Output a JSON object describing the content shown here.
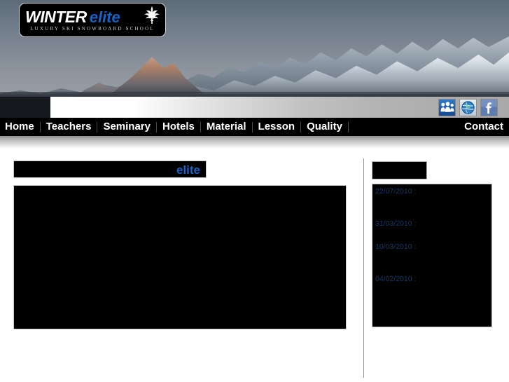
{
  "site": {
    "logo": {
      "brand_primary": "WINTER",
      "brand_secondary": "elite",
      "tagline": "LUXURY  SKI  SNOWBOARD  SCHOOL",
      "accent_color": "#1763c6",
      "icon": "fleur-de-lis-icon"
    }
  },
  "nav": {
    "items": [
      {
        "label": "Home"
      },
      {
        "label": "Teachers"
      },
      {
        "label": "Seminary"
      },
      {
        "label": "Hotels"
      },
      {
        "label": "Material"
      },
      {
        "label": "Lesson"
      },
      {
        "label": "Quality"
      }
    ],
    "contact": {
      "label": "Contact"
    }
  },
  "social": {
    "items": [
      {
        "name": "myspace-icon",
        "color": "#1f5fb0"
      },
      {
        "name": "globe-icon",
        "color": "#2a6fb5"
      },
      {
        "name": "facebook-icon",
        "color": "#3b5998"
      }
    ]
  },
  "main": {
    "title_accent": "elite",
    "title_hidden": "",
    "body": ""
  },
  "sidebar": {
    "heading": "",
    "news": [
      {
        "date": "22/07/2010 :",
        "body": ""
      },
      {
        "date": "31/03/2010 :",
        "body": ""
      },
      {
        "date": "10/03/2010 :",
        "body": ""
      },
      {
        "date": "04/02/2010 :",
        "body": ""
      }
    ]
  },
  "colors": {
    "accent": "#1763c6",
    "news_date": "#17396e",
    "panel_bg": "#000000",
    "page_bg": "#ffffff"
  }
}
